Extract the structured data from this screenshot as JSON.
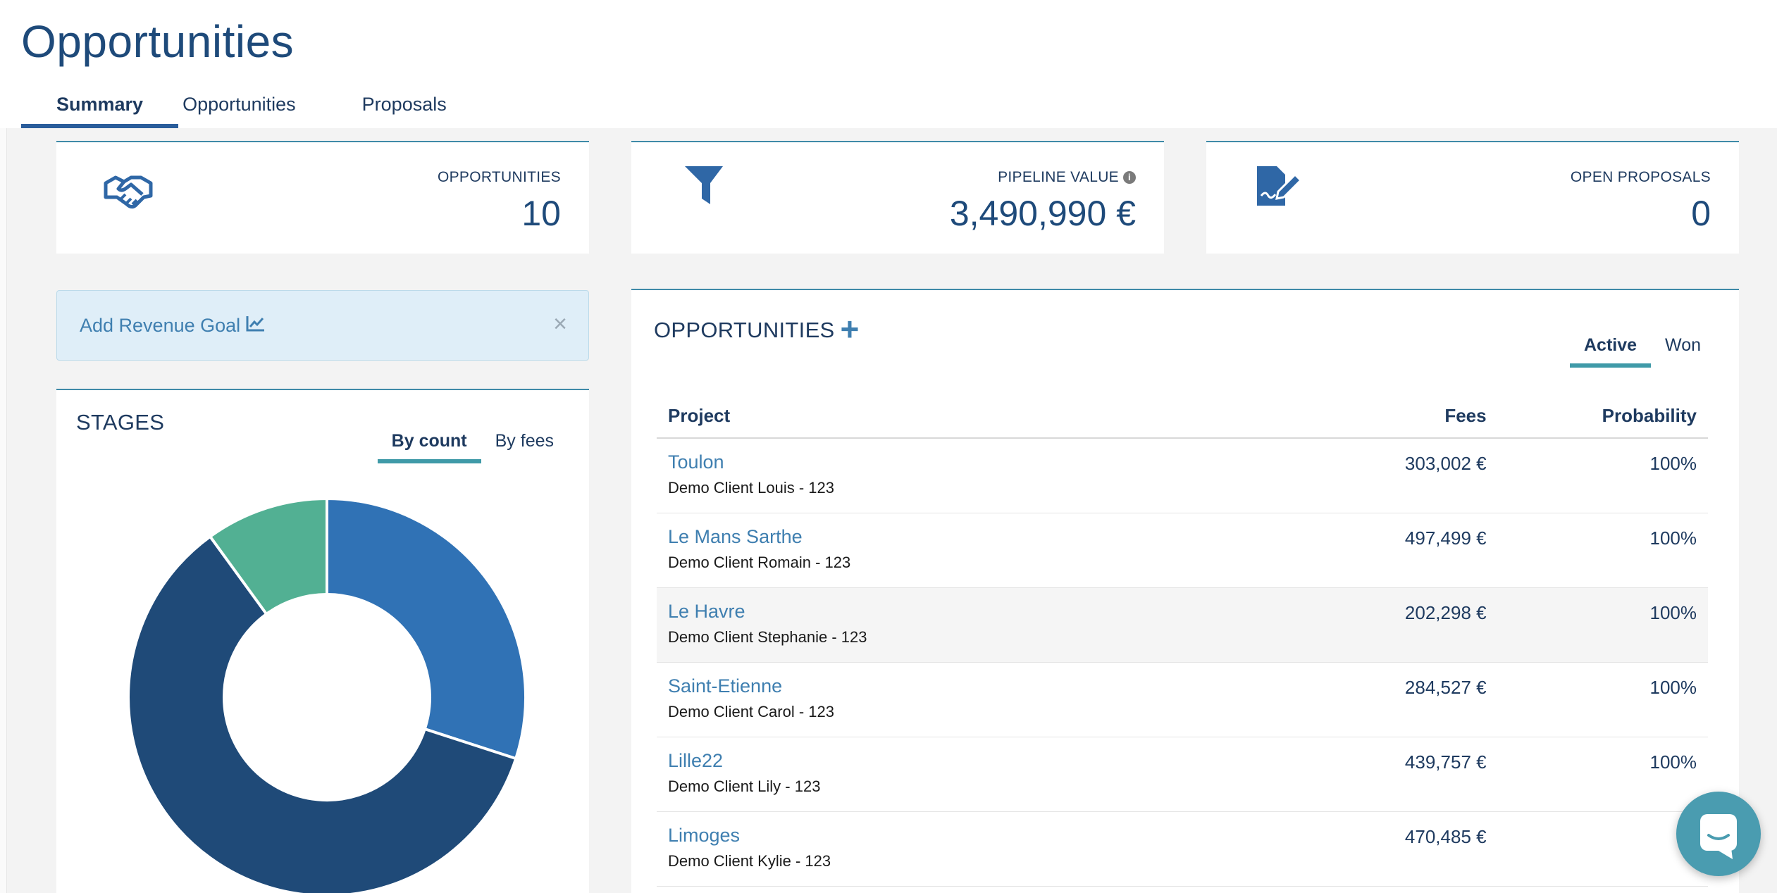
{
  "page": {
    "title": "Opportunities"
  },
  "tabs": [
    {
      "label": "Summary",
      "active": true
    },
    {
      "label": "Opportunities",
      "active": false
    },
    {
      "label": "Proposals",
      "active": false
    }
  ],
  "kpis": [
    {
      "label": "OPPORTUNITIES",
      "value": "10",
      "icon": "handshake-icon"
    },
    {
      "label": "PIPELINE VALUE",
      "value": "3,490,990 €",
      "icon": "funnel-icon",
      "info_icon": "i"
    },
    {
      "label": "OPEN PROPOSALS",
      "value": "0",
      "icon": "signed-document-icon"
    }
  ],
  "goal_banner": {
    "label": "Add Revenue Goal",
    "icon": "line-chart-icon",
    "close": "×"
  },
  "stages": {
    "title": "STAGES",
    "toggle": [
      {
        "label": "By count",
        "active": true
      },
      {
        "label": "By fees",
        "active": false
      }
    ]
  },
  "chart_data": {
    "type": "pie",
    "donut": true,
    "title": "STAGES",
    "values": [
      3,
      6,
      1
    ],
    "colors": [
      "#3072b5",
      "#1f4a78",
      "#52b093"
    ]
  },
  "opportunities": {
    "title": "OPPORTUNITIES",
    "add_icon": "+",
    "toggle": [
      {
        "label": "Active",
        "active": true
      },
      {
        "label": "Won",
        "active": false
      }
    ],
    "columns": {
      "project": "Project",
      "fees": "Fees",
      "probability": "Probability"
    },
    "rows": [
      {
        "project": "Toulon",
        "client": "Demo Client Louis - 123",
        "fees": "303,002 €",
        "probability": "100%"
      },
      {
        "project": "Le Mans Sarthe",
        "client": "Demo Client Romain - 123",
        "fees": "497,499 €",
        "probability": "100%"
      },
      {
        "project": "Le Havre",
        "client": "Demo Client Stephanie - 123",
        "fees": "202,298 €",
        "probability": "100%"
      },
      {
        "project": "Saint-Etienne",
        "client": "Demo Client Carol - 123",
        "fees": "284,527 €",
        "probability": "100%"
      },
      {
        "project": "Lille22",
        "client": "Demo Client Lily - 123",
        "fees": "439,757 €",
        "probability": "100%"
      },
      {
        "project": "Limoges",
        "client": "Demo Client Kylie - 123",
        "fees": "470,485 €",
        "probability": "10"
      }
    ]
  },
  "colors": {
    "accent": "#2a5d9b",
    "link": "#3f7fb0",
    "card_border": "#3f8aa8",
    "chat": "#4a9cb0"
  }
}
